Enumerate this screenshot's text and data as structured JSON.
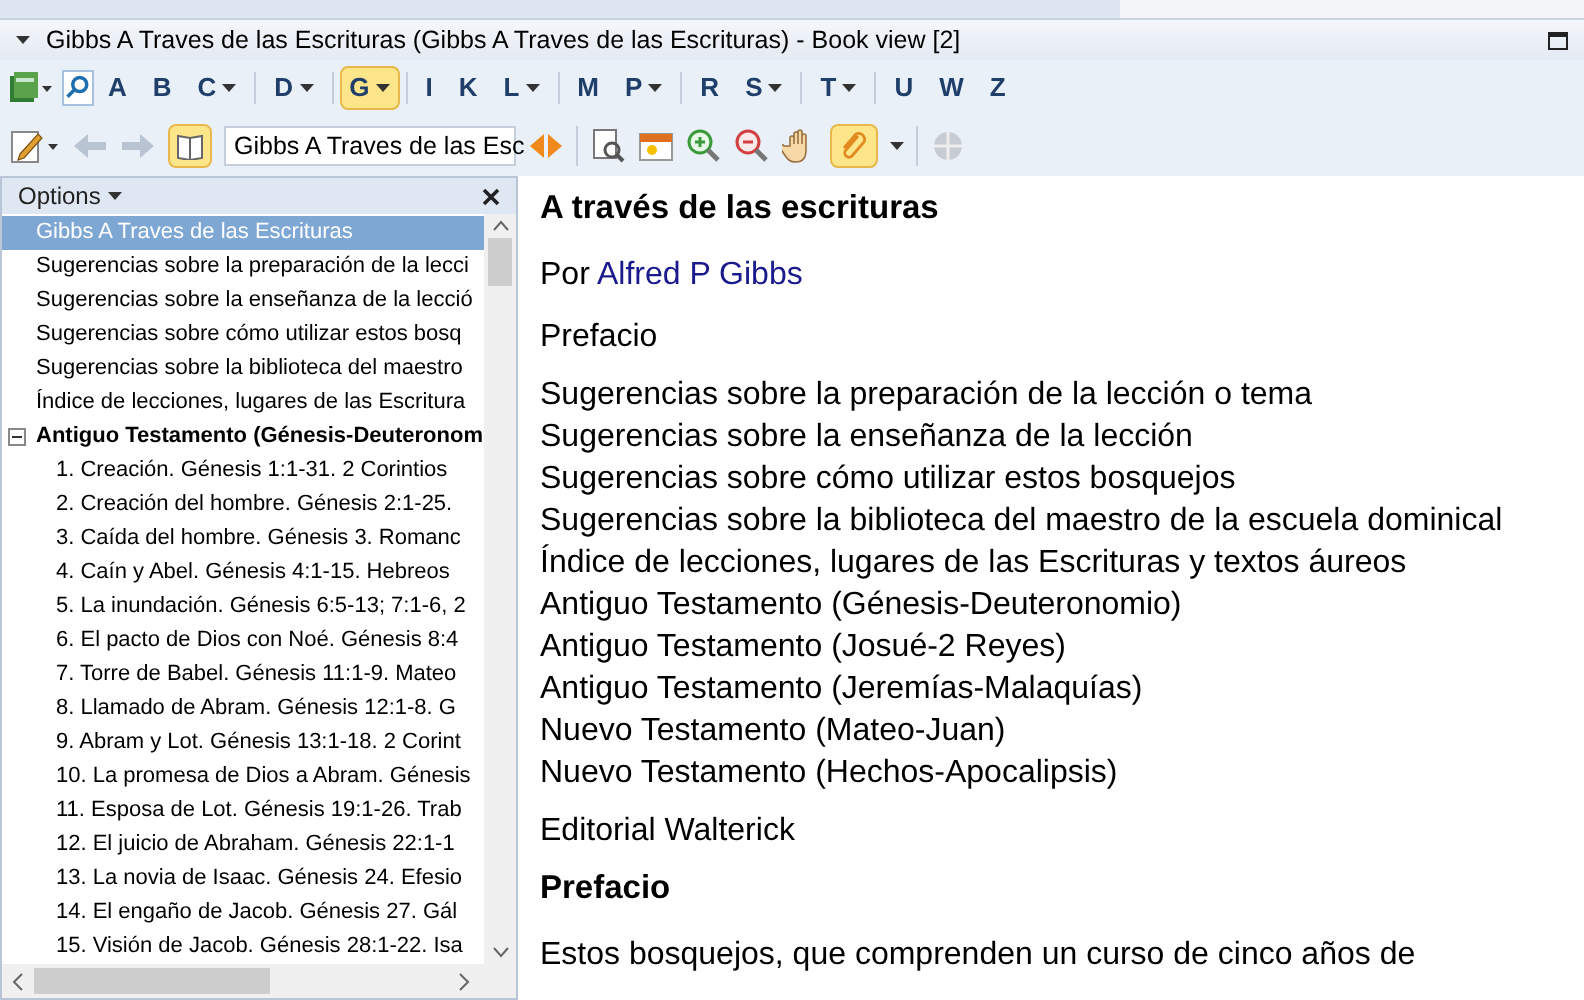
{
  "window": {
    "title": "Gibbs A Traves de las Escrituras (Gibbs A Traves de las Escrituras) - Book view [2]"
  },
  "letter_bar": [
    {
      "label": "A",
      "dropdown": false,
      "selected": false
    },
    {
      "label": "B",
      "dropdown": false,
      "selected": false
    },
    {
      "label": "C",
      "dropdown": true,
      "selected": false
    },
    {
      "label": "D",
      "dropdown": true,
      "selected": false
    },
    {
      "label": "G",
      "dropdown": true,
      "selected": true
    },
    {
      "label": "I",
      "dropdown": false,
      "selected": false
    },
    {
      "label": "K",
      "dropdown": false,
      "selected": false
    },
    {
      "label": "L",
      "dropdown": true,
      "selected": false
    },
    {
      "label": "M",
      "dropdown": false,
      "selected": false
    },
    {
      "label": "P",
      "dropdown": true,
      "selected": false
    },
    {
      "label": "R",
      "dropdown": false,
      "selected": false
    },
    {
      "label": "S",
      "dropdown": true,
      "selected": false
    },
    {
      "label": "T",
      "dropdown": true,
      "selected": false
    },
    {
      "label": "U",
      "dropdown": false,
      "selected": false
    },
    {
      "label": "W",
      "dropdown": false,
      "selected": false
    },
    {
      "label": "Z",
      "dropdown": false,
      "selected": false
    }
  ],
  "toolbar": {
    "book_combo": {
      "value": "Gibbs A Traves de las Esc"
    },
    "toc_toggle_on": true,
    "attachment_on": true,
    "nav_disabled": true
  },
  "sidebar": {
    "title": "Options",
    "items": [
      {
        "text": "Gibbs A Traves de las Escrituras",
        "selected": true
      },
      {
        "text": "Sugerencias sobre la preparación de la lecci",
        "selected": false
      },
      {
        "text": "Sugerencias sobre la enseñanza de la lecció",
        "selected": false
      },
      {
        "text": "Sugerencias sobre cómo utilizar estos bosq",
        "selected": false
      },
      {
        "text": "Sugerencias sobre la biblioteca del maestro",
        "selected": false
      },
      {
        "text": "Índice de lecciones, lugares de las Escritura",
        "selected": false
      },
      {
        "text": "Antiguo Testamento (Génesis-Deuteronom",
        "selected": false,
        "expanded": true,
        "children": [
          {
            "text": "1.  Creación.  Génesis 1:1-31.  2 Corintios",
            "selected": false
          },
          {
            "text": "2.  Creación del hombre.  Génesis 2:1-25.",
            "selected": false
          },
          {
            "text": "3.  Caída del hombre.  Génesis 3.  Romanc",
            "selected": false
          },
          {
            "text": "4.  Caín y Abel.  Génesis 4:1-15.  Hebreos",
            "selected": false
          },
          {
            "text": "5.  La inundación.  Génesis 6:5-13; 7:1-6, 2",
            "selected": false
          },
          {
            "text": "6.  El pacto de Dios con Noé.  Génesis 8:4",
            "selected": false
          },
          {
            "text": "7.  Torre de Babel.  Génesis 11:1-9.  Mateo",
            "selected": false
          },
          {
            "text": "8.  Llamado de Abram.  Génesis 12:1-8.  G",
            "selected": false
          },
          {
            "text": "9.  Abram y Lot.  Génesis 13:1-18.  2 Corint",
            "selected": false
          },
          {
            "text": "10.  La promesa de Dios a Abram.  Génesis",
            "selected": false
          },
          {
            "text": "11.  Esposa de Lot.  Génesis 19:1-26.  Trab",
            "selected": false
          },
          {
            "text": "12.  El juicio de Abraham.  Génesis 22:1-1",
            "selected": false
          },
          {
            "text": "13.  La novia de Isaac.  Génesis 24.  Efesio",
            "selected": false
          },
          {
            "text": "14.  El engaño de Jacob.  Génesis 27.  Gál",
            "selected": false
          },
          {
            "text": "15.  Visión de Jacob.  Génesis 28:1-22.  Isa",
            "selected": false
          }
        ]
      }
    ]
  },
  "document": {
    "blocks": [
      {
        "kind": "heading",
        "text": "A través de las escrituras"
      },
      {
        "kind": "byline",
        "prefix": "Por",
        "link": "Alfred P Gibbs"
      },
      {
        "kind": "para",
        "lines": [
          "Prefacio"
        ]
      },
      {
        "kind": "para",
        "lines": [
          "Sugerencias sobre la preparación de la lección o tema",
          "Sugerencias sobre la enseñanza de la lección",
          "Sugerencias sobre cómo utilizar estos bosquejos",
          "Sugerencias sobre la biblioteca del maestro de la escuela dominical",
          "Índice de lecciones, lugares de las Escrituras y textos áureos",
          "Antiguo Testamento (Génesis-Deuteronomio)",
          "Antiguo Testamento (Josué-2 Reyes)",
          "Antiguo Testamento (Jeremías-Malaquías)",
          "Nuevo Testamento (Mateo-Juan)",
          "Nuevo Testamento (Hechos-Apocalipsis)"
        ]
      },
      {
        "kind": "para",
        "lines": [
          "Editorial Walterick"
        ]
      },
      {
        "kind": "heading",
        "text": "Prefacio"
      },
      {
        "kind": "para",
        "lines": [
          "Estos bosquejos, que comprenden un curso de cinco años de"
        ]
      }
    ]
  }
}
